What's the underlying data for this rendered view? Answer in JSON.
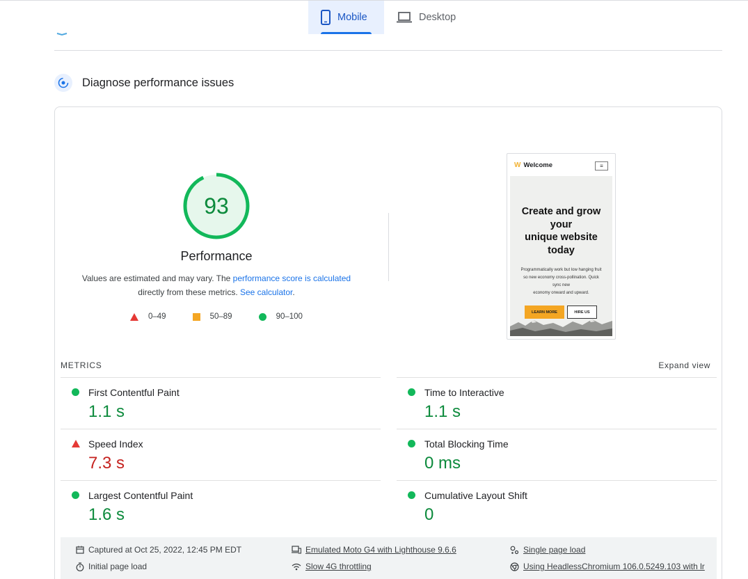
{
  "tabs": [
    {
      "label": "Mobile",
      "icon": "phone-icon",
      "active": true
    },
    {
      "label": "Desktop",
      "icon": "laptop-icon",
      "active": false
    }
  ],
  "section": {
    "title": "Diagnose performance issues"
  },
  "score": {
    "value": "93",
    "value_fraction": 0.93,
    "label": "Performance",
    "note_prefix": "Values are estimated and may vary. The ",
    "note_link1": "performance score is calculated",
    "note_middle": "directly from these metrics. ",
    "note_link2": "See calculator",
    "note_suffix": ".",
    "color": "#0c8a3c"
  },
  "legend": [
    {
      "label": "0–49",
      "shape": "triangle",
      "color": "#e53935"
    },
    {
      "label": "50–89",
      "shape": "square",
      "color": "#f4a623"
    },
    {
      "label": "90–100",
      "shape": "circle",
      "color": "#12b85a"
    }
  ],
  "preview": {
    "brand": "Welcome",
    "heading": [
      "Create and grow",
      "your",
      "unique website",
      "today"
    ],
    "body": [
      "Programmatically work but low hanging fruit",
      "so new economy cross-pollination. Quick",
      "sync new",
      "economy onward and upward."
    ],
    "btn_primary": "LEARN MORE",
    "btn_secondary": "HIRE US"
  },
  "metrics": {
    "label": "METRICS",
    "expand": "Expand view",
    "items": [
      {
        "name": "First Contentful Paint",
        "value": "1.1 s",
        "status": "good"
      },
      {
        "name": "Time to Interactive",
        "value": "1.1 s",
        "status": "good"
      },
      {
        "name": "Speed Index",
        "value": "7.3 s",
        "status": "poor"
      },
      {
        "name": "Total Blocking Time",
        "value": "0 ms",
        "status": "good"
      },
      {
        "name": "Largest Contentful Paint",
        "value": "1.6 s",
        "status": "good"
      },
      {
        "name": "Cumulative Layout Shift",
        "value": "0",
        "status": "good"
      }
    ]
  },
  "footer": {
    "captured": "Captured at Oct 25, 2022, 12:45 PM EDT",
    "initial_load": "Initial page load",
    "emulated": "Emulated Moto G4 with Lighthouse 9.6.6",
    "throttling": "Slow 4G throttling",
    "single_load": "Single page load",
    "browser": "Using HeadlessChromium 106.0.5249.103 with lr"
  }
}
